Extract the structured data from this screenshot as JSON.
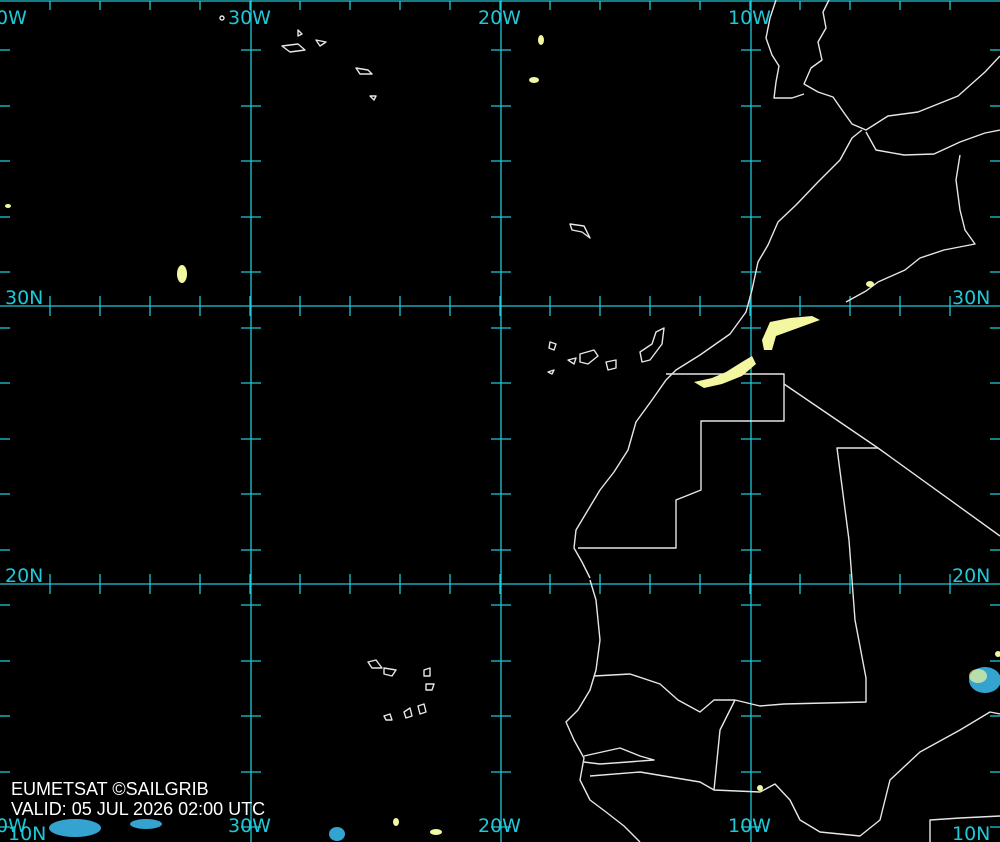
{
  "map": {
    "grid_labels": {
      "lon": [
        "30W",
        "20W",
        "10W"
      ],
      "lat": [
        "30N",
        "20N",
        "10N"
      ],
      "partial_left": [
        "0W",
        "10N",
        "0W"
      ]
    },
    "colors": {
      "background": "#000000",
      "grid": "#1fc8d8",
      "coastline": "#e6e6e6",
      "cloud_low": "#f2f7a0",
      "cloud_high": "#35a3d0"
    }
  },
  "credit": {
    "line1": "EUMETSAT ©SAILGRIB",
    "line2": "VALID:  05 JUL 2026 02:00 UTC"
  }
}
